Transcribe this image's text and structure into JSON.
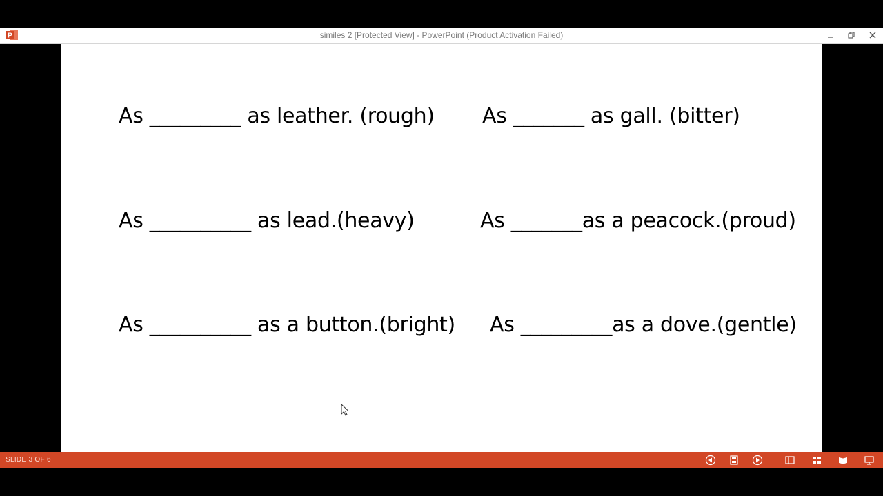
{
  "window": {
    "title": "similes 2 [Protected View] - PowerPoint (Product Activation Failed)",
    "icons": [
      "powerpoint-app-icon",
      "minimize-icon",
      "restore-icon",
      "close-icon"
    ]
  },
  "slide": {
    "lines": [
      "As _________ as leather. (rough)",
      "As _______ as gall. (bitter)",
      "As __________ as lead.(heavy)",
      "As _______as a peacock.(proud)",
      "As __________ as a button.(bright)",
      "As _________as a dove.(gentle)"
    ]
  },
  "status": {
    "slide_counter": "SLIDE 3 OF 6",
    "icons": [
      "previous-slide-icon",
      "slide-navigator-icon",
      "next-slide-icon",
      "normal-view-icon",
      "slide-sorter-icon",
      "reading-view-icon",
      "slide-show-icon"
    ]
  },
  "colors": {
    "status_bar": "#d24726",
    "app_accent": "#d24726",
    "slide_background": "#ffffff",
    "stage_background": "#000000"
  }
}
